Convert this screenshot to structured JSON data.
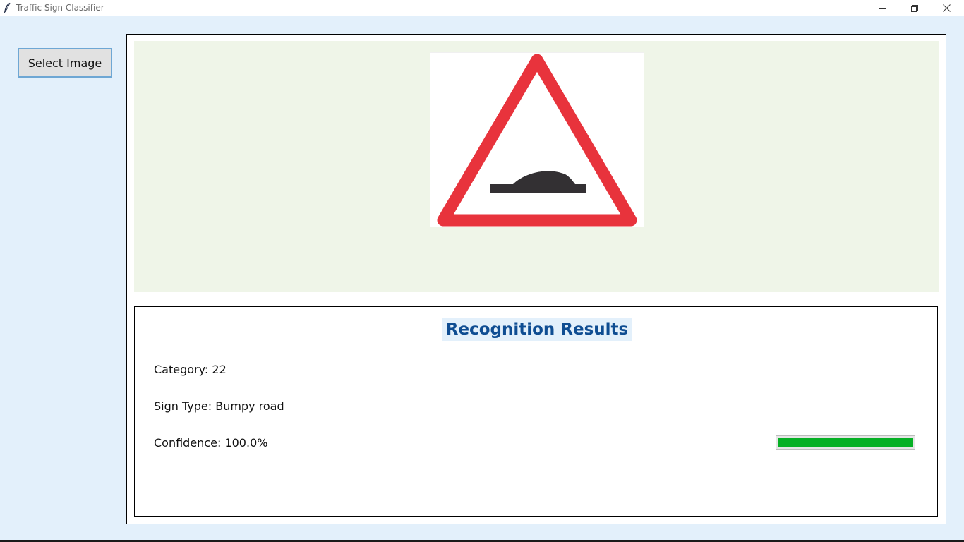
{
  "window": {
    "title": "Traffic Sign Classifier",
    "controls": [
      "minimize",
      "restore",
      "close"
    ]
  },
  "sidebar": {
    "select_button_label": "Select Image"
  },
  "image_panel": {
    "sign_icon": "bumpy-road-warning-sign",
    "colors": {
      "border_red": "#e8333c",
      "bump": "#333033",
      "panel_background": "#eff5e8"
    }
  },
  "results": {
    "title": "Recognition Results",
    "category_text": "Category: 22",
    "sign_type_text": "Sign Type: Bumpy road",
    "confidence_text": "Confidence: 100.0%",
    "confidence_value": 1.0,
    "confidence_bar_color": "#06b025",
    "title_color": "#0f4d92"
  }
}
